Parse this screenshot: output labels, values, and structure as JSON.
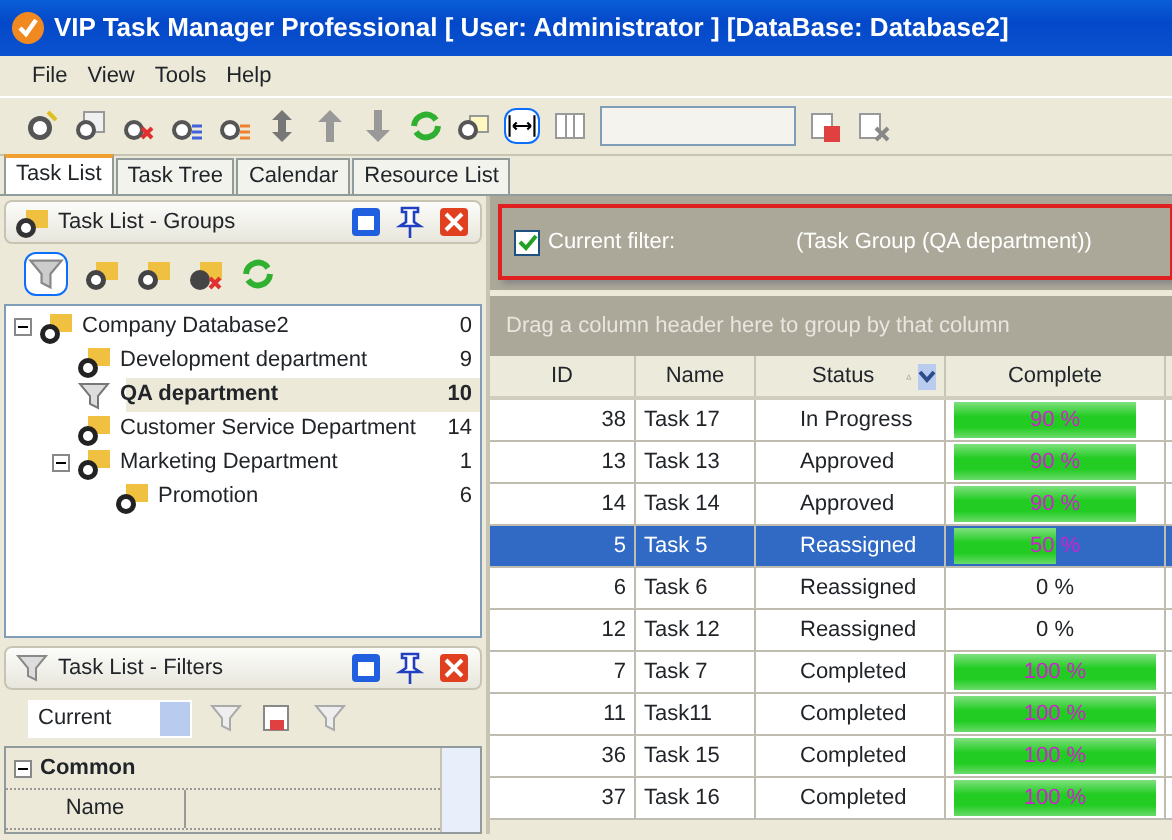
{
  "window": {
    "title": "VIP Task Manager Professional [ User: Administrator ] [DataBase: Database2]"
  },
  "menu": [
    "File",
    "View",
    "Tools",
    "Help"
  ],
  "tabs": [
    {
      "label": "Task List",
      "selected": true
    },
    {
      "label": "Task Tree",
      "selected": false
    },
    {
      "label": "Calendar",
      "selected": false
    },
    {
      "label": "Resource List",
      "selected": false
    }
  ],
  "groups_panel": {
    "title": "Task List - Groups",
    "tree": [
      {
        "label": "Company Database2",
        "count": "0",
        "expanded": true,
        "selected": false,
        "children": [
          {
            "label": "Development department",
            "count": "9",
            "selected": false
          },
          {
            "label": "QA department",
            "count": "10",
            "selected": true
          },
          {
            "label": "Customer Service Department",
            "count": "14",
            "selected": false
          },
          {
            "label": "Marketing Department",
            "count": "1",
            "expanded": true,
            "selected": false,
            "children": [
              {
                "label": "Promotion",
                "count": "6",
                "selected": false
              }
            ]
          }
        ]
      }
    ]
  },
  "filters_panel": {
    "title": "Task List - Filters",
    "filter_select": "Current",
    "category": {
      "label": "Common",
      "expanded": true
    },
    "properties": [
      {
        "label": "Name"
      }
    ]
  },
  "filter_bar": {
    "checked": true,
    "label": "Current filter:",
    "expression": "(Task Group  (QA department))"
  },
  "group_hint": "Drag a column header here to group by that column",
  "table": {
    "columns": [
      "ID",
      "Name",
      "Status",
      "Complete"
    ],
    "rows": [
      {
        "id": "38",
        "name": "Task 17",
        "status": "In Progress",
        "complete": "90 %",
        "level": 0.9,
        "selected": false
      },
      {
        "id": "13",
        "name": "Task 13",
        "status": "Approved",
        "complete": "90 %",
        "level": 0.9,
        "selected": false
      },
      {
        "id": "14",
        "name": "Task 14",
        "status": "Approved",
        "complete": "90 %",
        "level": 0.9,
        "selected": false
      },
      {
        "id": "5",
        "name": "Task 5",
        "status": "Reassigned",
        "complete": "50 %",
        "level": 0.5,
        "selected": true
      },
      {
        "id": "6",
        "name": "Task 6",
        "status": "Reassigned",
        "complete": "0 %",
        "selected": false
      },
      {
        "id": "12",
        "name": "Task 12",
        "status": "Reassigned",
        "complete": "0 %",
        "selected": false
      },
      {
        "id": "7",
        "name": "Task 7",
        "status": "Completed",
        "complete": "100 %",
        "level": 1,
        "selected": false
      },
      {
        "id": "11",
        "name": "Task11",
        "status": "Completed",
        "complete": "100 %",
        "level": 1,
        "selected": false
      },
      {
        "id": "36",
        "name": "Task 15",
        "status": "Completed",
        "complete": "100 %",
        "level": 1,
        "selected": false
      },
      {
        "id": "37",
        "name": "Task 16",
        "status": "Completed",
        "complete": "100 %",
        "level": 1,
        "selected": false
      }
    ]
  }
}
